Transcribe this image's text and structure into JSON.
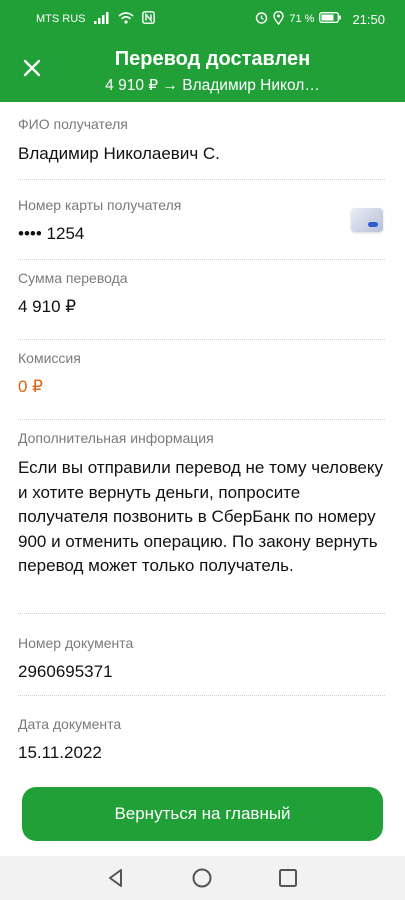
{
  "status_bar": {
    "carrier": "MTS RUS",
    "battery": "71 %",
    "time": "21:50",
    "icons": [
      "signal-icon",
      "wifi-icon",
      "nfc-icon",
      "alarm-icon",
      "location-icon",
      "battery-icon"
    ]
  },
  "header": {
    "title": "Перевод доставлен",
    "subtitle": "4 910 ₽ → Владимир Никол…",
    "close_icon": "close-icon",
    "background": "#21a038"
  },
  "fields": {
    "recipient_name": {
      "label": "ФИО получателя",
      "value": "Владимир Николаевич С."
    },
    "card_number": {
      "label": "Номер карты получателя",
      "value": "•••• 1254",
      "icon": "card-icon"
    },
    "amount": {
      "label": "Сумма перевода",
      "value": "4 910 ₽"
    },
    "commission": {
      "label": "Комиссия",
      "value": "0 ₽",
      "color": "#e0620e"
    },
    "additional_info": {
      "label": "Дополнительная информация",
      "value": "Если вы отправили перевод не тому человеку и хотите вернуть деньги, попросите получателя позвонить в СберБанк по номеру 900 и отменить операцию. По закону вернуть перевод может только получатель."
    },
    "document_number": {
      "label": "Номер документа",
      "value": "2960695371"
    },
    "document_date": {
      "label": "Дата документа",
      "value": "15.11.2022"
    }
  },
  "actions": {
    "home_button_label": "Вернуться на главный"
  },
  "nav_bar": {
    "icons": [
      "back-icon",
      "home-icon",
      "recents-icon"
    ]
  }
}
